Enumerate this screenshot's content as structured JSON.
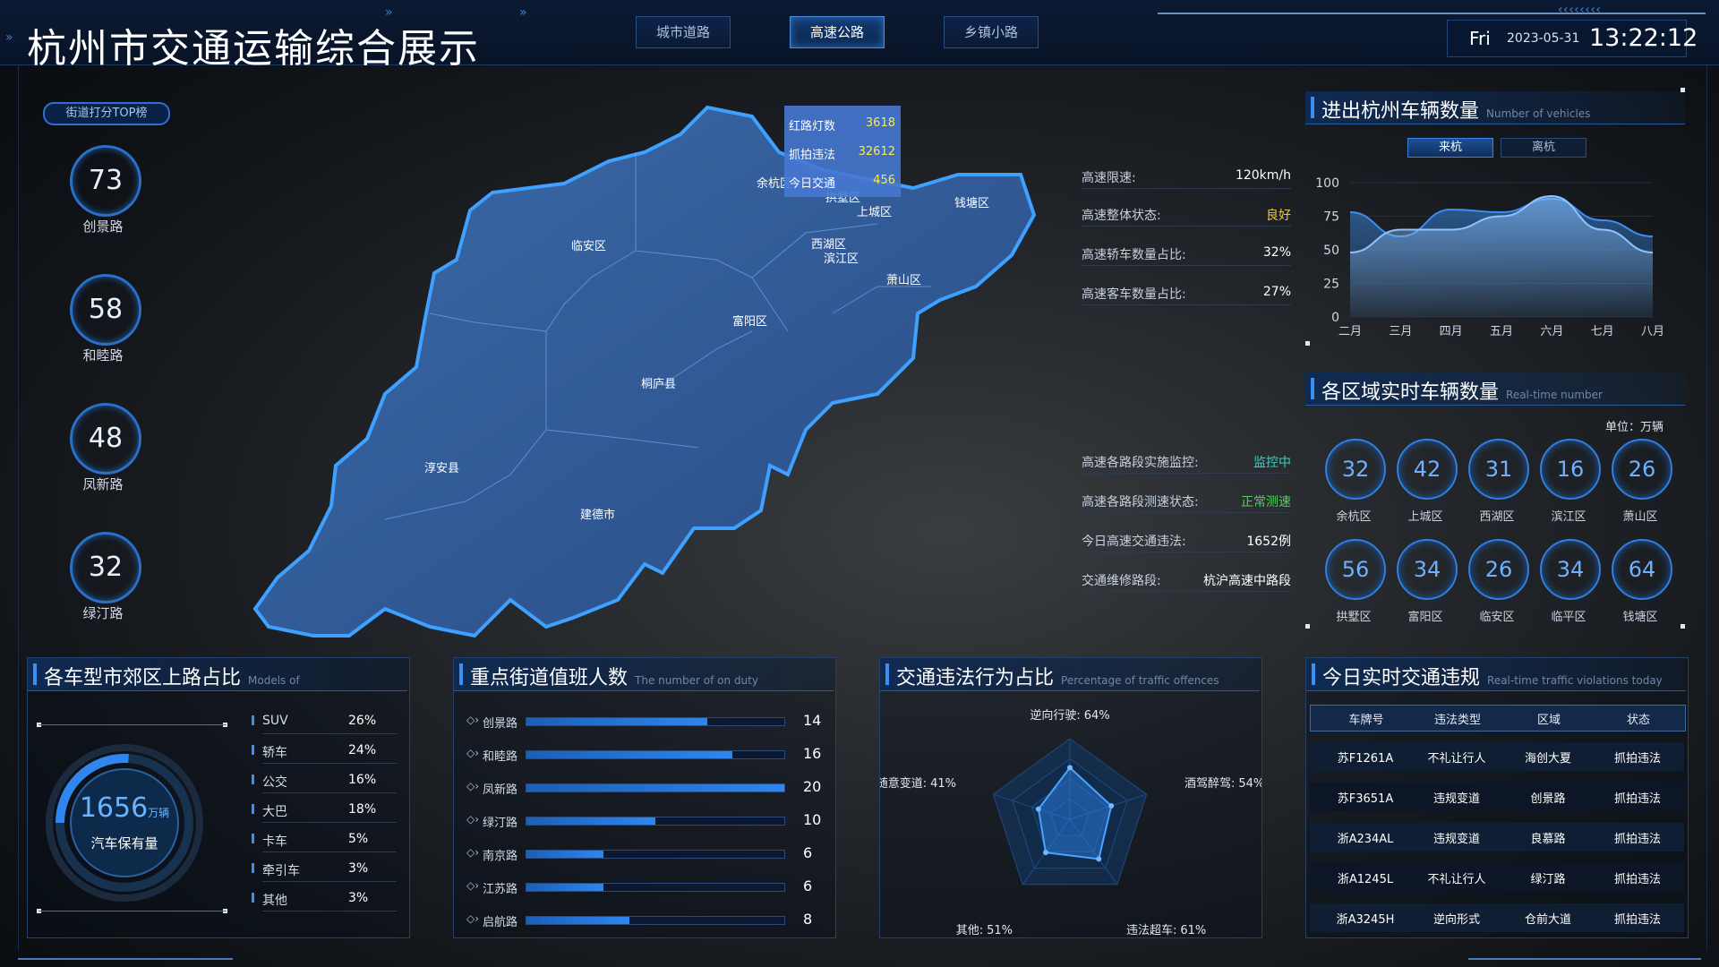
{
  "header": {
    "title": "杭州市交通运输综合展示",
    "tabs": [
      {
        "label": "城市道路",
        "active": false
      },
      {
        "label": "高速公路",
        "active": true
      },
      {
        "label": "乡镇小路",
        "active": false
      }
    ],
    "day": "Fri",
    "date": "2023-05-31",
    "time": "13:22:12"
  },
  "street_rank": {
    "badge": "街道打分TOP榜",
    "items": [
      {
        "score": "73",
        "name": "创景路"
      },
      {
        "score": "58",
        "name": "和睦路"
      },
      {
        "score": "48",
        "name": "凤新路"
      },
      {
        "score": "32",
        "name": "绿汀路"
      }
    ]
  },
  "map": {
    "popup": [
      {
        "label": "红路灯数",
        "value": "3618"
      },
      {
        "label": "抓拍违法",
        "value": "32612"
      },
      {
        "label": "今日交通",
        "value": "456"
      }
    ],
    "districts": [
      "余杭区",
      "拱墅区",
      "上城区",
      "钱塘区",
      "临安区",
      "西湖区",
      "滨江区",
      "萧山区",
      "富阳区",
      "桐庐县",
      "淳安县",
      "建德市"
    ]
  },
  "highway_stats": [
    {
      "label": "高速限速:",
      "value": "120km/h",
      "color": "#ffffff"
    },
    {
      "label": "高速整体状态:",
      "value": "良好",
      "color": "#e6c84a"
    },
    {
      "label": "高速轿车数量占比:",
      "value": "32%",
      "color": "#ffffff"
    },
    {
      "label": "高速客车数量占比:",
      "value": "27%",
      "color": "#ffffff"
    }
  ],
  "highway_stats2": [
    {
      "label": "高速各路段实施监控:",
      "value": "监控中",
      "color": "#3fd0c0"
    },
    {
      "label": "高速各路段测速状态:",
      "value": "正常测速",
      "color": "#52d05a"
    },
    {
      "label": "今日高速交通违法:",
      "value": "1652例",
      "color": "#ffffff"
    },
    {
      "label": "交通维修路段:",
      "value": "杭沪高速中路段",
      "color": "#ffffff"
    }
  ],
  "vehicles_panel": {
    "title": "进出杭州车辆数量",
    "subtitle": "Number of vehicles",
    "tabs": [
      {
        "label": "来杭",
        "active": true
      },
      {
        "label": "离杭",
        "active": false
      }
    ]
  },
  "chart_data": {
    "type": "area",
    "categories": [
      "二月",
      "三月",
      "四月",
      "五月",
      "六月",
      "七月",
      "八月"
    ],
    "ylim": [
      0,
      100
    ],
    "yticks": [
      "100",
      "75",
      "50",
      "25",
      "0"
    ],
    "series": [
      {
        "values": [
          78,
          60,
          80,
          78,
          88,
          72,
          60
        ]
      },
      {
        "values": [
          48,
          65,
          65,
          75,
          90,
          65,
          48
        ]
      }
    ],
    "colors": [
      "#3a8ff0",
      "#8fc3ff"
    ]
  },
  "districts_panel": {
    "title": "各区域实时车辆数量",
    "subtitle": "Real-time number",
    "unit": "单位：万辆",
    "items": [
      {
        "value": "32",
        "name": "余杭区"
      },
      {
        "value": "42",
        "name": "上城区"
      },
      {
        "value": "31",
        "name": "西湖区"
      },
      {
        "value": "16",
        "name": "滨江区"
      },
      {
        "value": "26",
        "name": "萧山区"
      },
      {
        "value": "56",
        "name": "拱墅区"
      },
      {
        "value": "34",
        "name": "富阳区"
      },
      {
        "value": "26",
        "name": "临安区"
      },
      {
        "value": "34",
        "name": "临平区"
      },
      {
        "value": "64",
        "name": "钱塘区"
      }
    ]
  },
  "models_panel": {
    "title": "各车型市郊区上路占比",
    "subtitle": "Models of",
    "total": "1656",
    "total_unit": "万辆",
    "total_label": "汽车保有量",
    "total_fraction": 0.26,
    "items": [
      {
        "name": "SUV",
        "pct": "26%"
      },
      {
        "name": "轿车",
        "pct": "24%"
      },
      {
        "name": "公交",
        "pct": "16%"
      },
      {
        "name": "大巴",
        "pct": "18%"
      },
      {
        "name": "卡车",
        "pct": "5%"
      },
      {
        "name": "牵引车",
        "pct": "3%"
      },
      {
        "name": "其他",
        "pct": "3%"
      }
    ]
  },
  "duty_panel": {
    "title": "重点街道值班人数",
    "subtitle": "The number of on duty",
    "max": 20,
    "items": [
      {
        "name": "创景路",
        "value": 14
      },
      {
        "name": "和睦路",
        "value": 16
      },
      {
        "name": "凤新路",
        "value": 20
      },
      {
        "name": "绿汀路",
        "value": 10
      },
      {
        "name": "南京路",
        "value": 6
      },
      {
        "name": "江苏路",
        "value": 6
      },
      {
        "name": "启航路",
        "value": 8
      }
    ]
  },
  "offence_panel": {
    "title": "交通违法行为占比",
    "subtitle": "Percentage of traffic offences",
    "items": [
      {
        "name": "逆向行驶:",
        "pct": "64%",
        "value": 64
      },
      {
        "name": "酒驾醉驾:",
        "pct": "54%",
        "value": 54
      },
      {
        "name": "违法超车:",
        "pct": "61%",
        "value": 61
      },
      {
        "name": "其他:",
        "pct": "51%",
        "value": 51
      },
      {
        "name": "随意变道:",
        "pct": "41%",
        "value": 41
      }
    ]
  },
  "violations_panel": {
    "title": "今日实时交通违规",
    "subtitle": "Real-time traffic violations today",
    "headers": [
      "车牌号",
      "违法类型",
      "区域",
      "状态"
    ],
    "rows": [
      [
        "苏F1261A",
        "不礼让行人",
        "海创大夏",
        "抓拍违法"
      ],
      [
        "苏F3651A",
        "违规变道",
        "创景路",
        "抓拍违法"
      ],
      [
        "浙A234AL",
        "违规变道",
        "良慕路",
        "抓拍违法"
      ],
      [
        "浙A1245L",
        "不礼让行人",
        "绿汀路",
        "抓拍违法"
      ],
      [
        "浙A3245H",
        "逆向形式",
        "仓前大道",
        "抓拍违法"
      ]
    ]
  }
}
